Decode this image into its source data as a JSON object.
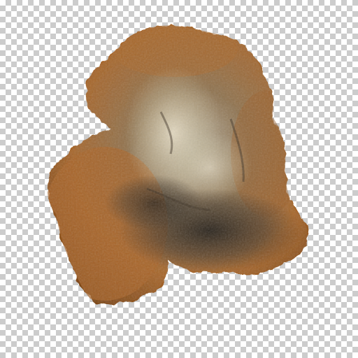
{
  "image": {
    "subject": "rock",
    "background": "transparency-checkerboard",
    "colors": {
      "checker_light": "#ffffff",
      "checker_dark": "#cccccc",
      "rock_edge": "#8a4f1c",
      "rock_body": "#a86a2e",
      "rock_highlight": "#d8c7a8",
      "rock_shadow": "#2a2520"
    }
  }
}
